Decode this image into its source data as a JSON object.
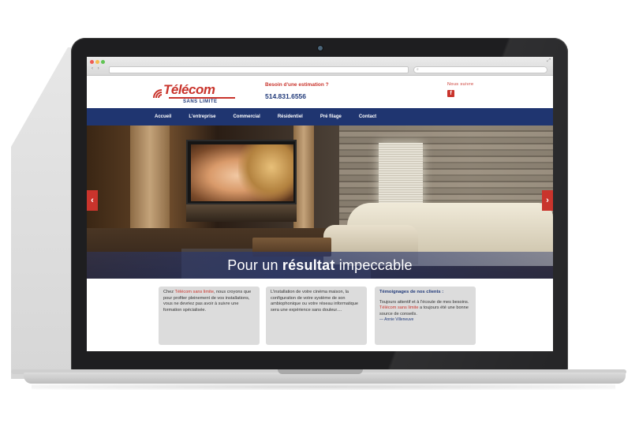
{
  "browser": {
    "url": "",
    "search_placeholder": "",
    "nav_arrows": "‹ ›"
  },
  "header": {
    "logo_name": "Télécom",
    "logo_sub": "SANS  LIMITE",
    "estimate_label": "Besoin d'une estimation ?",
    "phone": "514.831.6556",
    "follow_label": "Nous suivre",
    "facebook_glyph": "f"
  },
  "nav": {
    "items": [
      "Accueil",
      "L'entreprise",
      "Commercial",
      "Résidentiel",
      "Pré filage",
      "Contact"
    ]
  },
  "hero": {
    "caption_pre": "Pour un ",
    "caption_bold": "résultat",
    "caption_post": " impeccable",
    "prev_glyph": "‹",
    "next_glyph": "›"
  },
  "cards": [
    {
      "pre": "Chez ",
      "highlight": "Télécom sans limite",
      "post": ", nous croyons que pour profiter pleinement de vos installations, vous ne devriez pas avoir à suivre une formation spécialisée."
    },
    {
      "text": "L'installation de votre cinéma maison, la configuration de votre système de son ambiophonique ou votre réseau informatique sera une expérience sans douleur...."
    },
    {
      "title": "Témoignages de nos clients :",
      "pre": "Toujours attentif et à l'écoute de mes besoins. ",
      "highlight": "Télécom sans limite",
      "post": " a toujours été une bonne source de conseils.",
      "signature": "— Annie Villeneuve"
    }
  ],
  "colors": {
    "brand_red": "#c9342c",
    "brand_navy": "#1f3570"
  }
}
